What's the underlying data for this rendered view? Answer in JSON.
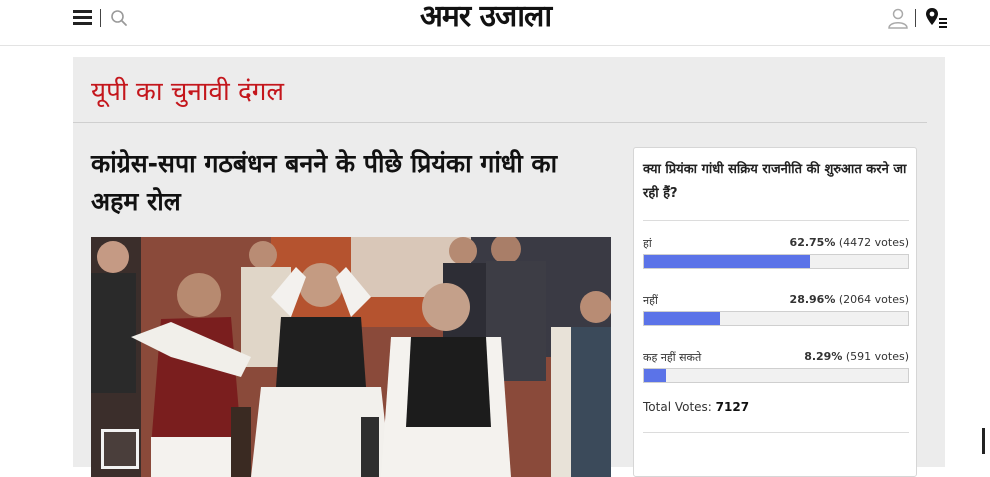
{
  "header": {
    "logo_text": "अमर उजाला",
    "menu_icon": "hamburger-menu-icon",
    "search_icon": "search-icon",
    "user_icon": "user-icon",
    "location_icon": "location-pin-icon"
  },
  "section": {
    "title": "यूपी का चुनावी दंगल"
  },
  "article": {
    "headline": "कांग्रेस-सपा गठबंधन बनने के पीछे प्रियंका गांधी का अहम रोल"
  },
  "poll": {
    "question": "क्या प्रियंका गांधी सक्रिय राजनीति की शुरुआत करने जा रही हैं?",
    "options": [
      {
        "label": "हां",
        "percent_text": "62.75%",
        "votes_text": "(4472 votes)",
        "fraction": 0.6275
      },
      {
        "label": "नहीं",
        "percent_text": "28.96%",
        "votes_text": "(2064 votes)",
        "fraction": 0.2896
      },
      {
        "label": "कह नहीं सकते",
        "percent_text": "8.29%",
        "votes_text": "(591 votes)",
        "fraction": 0.0829
      }
    ],
    "total_label": "Total Votes:",
    "total_value": "7127"
  },
  "colors": {
    "accent_red": "#c4161c",
    "poll_bar": "#5b73e8"
  }
}
